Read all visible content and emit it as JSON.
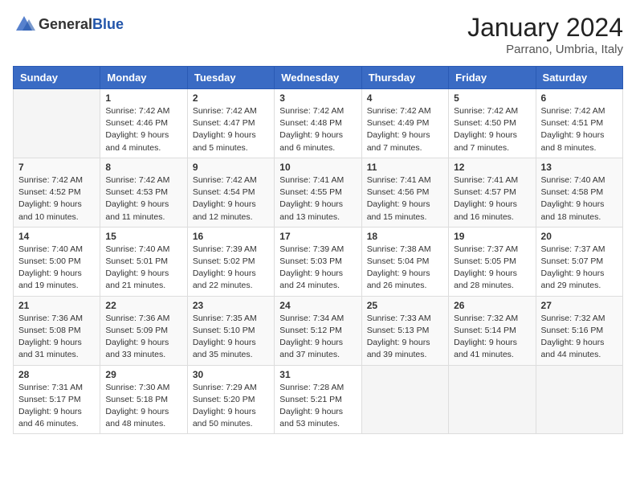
{
  "logo": {
    "general": "General",
    "blue": "Blue"
  },
  "header": {
    "month": "January 2024",
    "location": "Parrano, Umbria, Italy"
  },
  "weekdays": [
    "Sunday",
    "Monday",
    "Tuesday",
    "Wednesday",
    "Thursday",
    "Friday",
    "Saturday"
  ],
  "weeks": [
    [
      {
        "day": "",
        "sunrise": "",
        "sunset": "",
        "daylight": ""
      },
      {
        "day": "1",
        "sunrise": "Sunrise: 7:42 AM",
        "sunset": "Sunset: 4:46 PM",
        "daylight": "Daylight: 9 hours and 4 minutes."
      },
      {
        "day": "2",
        "sunrise": "Sunrise: 7:42 AM",
        "sunset": "Sunset: 4:47 PM",
        "daylight": "Daylight: 9 hours and 5 minutes."
      },
      {
        "day": "3",
        "sunrise": "Sunrise: 7:42 AM",
        "sunset": "Sunset: 4:48 PM",
        "daylight": "Daylight: 9 hours and 6 minutes."
      },
      {
        "day": "4",
        "sunrise": "Sunrise: 7:42 AM",
        "sunset": "Sunset: 4:49 PM",
        "daylight": "Daylight: 9 hours and 7 minutes."
      },
      {
        "day": "5",
        "sunrise": "Sunrise: 7:42 AM",
        "sunset": "Sunset: 4:50 PM",
        "daylight": "Daylight: 9 hours and 7 minutes."
      },
      {
        "day": "6",
        "sunrise": "Sunrise: 7:42 AM",
        "sunset": "Sunset: 4:51 PM",
        "daylight": "Daylight: 9 hours and 8 minutes."
      }
    ],
    [
      {
        "day": "7",
        "sunrise": "Sunrise: 7:42 AM",
        "sunset": "Sunset: 4:52 PM",
        "daylight": "Daylight: 9 hours and 10 minutes."
      },
      {
        "day": "8",
        "sunrise": "Sunrise: 7:42 AM",
        "sunset": "Sunset: 4:53 PM",
        "daylight": "Daylight: 9 hours and 11 minutes."
      },
      {
        "day": "9",
        "sunrise": "Sunrise: 7:42 AM",
        "sunset": "Sunset: 4:54 PM",
        "daylight": "Daylight: 9 hours and 12 minutes."
      },
      {
        "day": "10",
        "sunrise": "Sunrise: 7:41 AM",
        "sunset": "Sunset: 4:55 PM",
        "daylight": "Daylight: 9 hours and 13 minutes."
      },
      {
        "day": "11",
        "sunrise": "Sunrise: 7:41 AM",
        "sunset": "Sunset: 4:56 PM",
        "daylight": "Daylight: 9 hours and 15 minutes."
      },
      {
        "day": "12",
        "sunrise": "Sunrise: 7:41 AM",
        "sunset": "Sunset: 4:57 PM",
        "daylight": "Daylight: 9 hours and 16 minutes."
      },
      {
        "day": "13",
        "sunrise": "Sunrise: 7:40 AM",
        "sunset": "Sunset: 4:58 PM",
        "daylight": "Daylight: 9 hours and 18 minutes."
      }
    ],
    [
      {
        "day": "14",
        "sunrise": "Sunrise: 7:40 AM",
        "sunset": "Sunset: 5:00 PM",
        "daylight": "Daylight: 9 hours and 19 minutes."
      },
      {
        "day": "15",
        "sunrise": "Sunrise: 7:40 AM",
        "sunset": "Sunset: 5:01 PM",
        "daylight": "Daylight: 9 hours and 21 minutes."
      },
      {
        "day": "16",
        "sunrise": "Sunrise: 7:39 AM",
        "sunset": "Sunset: 5:02 PM",
        "daylight": "Daylight: 9 hours and 22 minutes."
      },
      {
        "day": "17",
        "sunrise": "Sunrise: 7:39 AM",
        "sunset": "Sunset: 5:03 PM",
        "daylight": "Daylight: 9 hours and 24 minutes."
      },
      {
        "day": "18",
        "sunrise": "Sunrise: 7:38 AM",
        "sunset": "Sunset: 5:04 PM",
        "daylight": "Daylight: 9 hours and 26 minutes."
      },
      {
        "day": "19",
        "sunrise": "Sunrise: 7:37 AM",
        "sunset": "Sunset: 5:05 PM",
        "daylight": "Daylight: 9 hours and 28 minutes."
      },
      {
        "day": "20",
        "sunrise": "Sunrise: 7:37 AM",
        "sunset": "Sunset: 5:07 PM",
        "daylight": "Daylight: 9 hours and 29 minutes."
      }
    ],
    [
      {
        "day": "21",
        "sunrise": "Sunrise: 7:36 AM",
        "sunset": "Sunset: 5:08 PM",
        "daylight": "Daylight: 9 hours and 31 minutes."
      },
      {
        "day": "22",
        "sunrise": "Sunrise: 7:36 AM",
        "sunset": "Sunset: 5:09 PM",
        "daylight": "Daylight: 9 hours and 33 minutes."
      },
      {
        "day": "23",
        "sunrise": "Sunrise: 7:35 AM",
        "sunset": "Sunset: 5:10 PM",
        "daylight": "Daylight: 9 hours and 35 minutes."
      },
      {
        "day": "24",
        "sunrise": "Sunrise: 7:34 AM",
        "sunset": "Sunset: 5:12 PM",
        "daylight": "Daylight: 9 hours and 37 minutes."
      },
      {
        "day": "25",
        "sunrise": "Sunrise: 7:33 AM",
        "sunset": "Sunset: 5:13 PM",
        "daylight": "Daylight: 9 hours and 39 minutes."
      },
      {
        "day": "26",
        "sunrise": "Sunrise: 7:32 AM",
        "sunset": "Sunset: 5:14 PM",
        "daylight": "Daylight: 9 hours and 41 minutes."
      },
      {
        "day": "27",
        "sunrise": "Sunrise: 7:32 AM",
        "sunset": "Sunset: 5:16 PM",
        "daylight": "Daylight: 9 hours and 44 minutes."
      }
    ],
    [
      {
        "day": "28",
        "sunrise": "Sunrise: 7:31 AM",
        "sunset": "Sunset: 5:17 PM",
        "daylight": "Daylight: 9 hours and 46 minutes."
      },
      {
        "day": "29",
        "sunrise": "Sunrise: 7:30 AM",
        "sunset": "Sunset: 5:18 PM",
        "daylight": "Daylight: 9 hours and 48 minutes."
      },
      {
        "day": "30",
        "sunrise": "Sunrise: 7:29 AM",
        "sunset": "Sunset: 5:20 PM",
        "daylight": "Daylight: 9 hours and 50 minutes."
      },
      {
        "day": "31",
        "sunrise": "Sunrise: 7:28 AM",
        "sunset": "Sunset: 5:21 PM",
        "daylight": "Daylight: 9 hours and 53 minutes."
      },
      {
        "day": "",
        "sunrise": "",
        "sunset": "",
        "daylight": ""
      },
      {
        "day": "",
        "sunrise": "",
        "sunset": "",
        "daylight": ""
      },
      {
        "day": "",
        "sunrise": "",
        "sunset": "",
        "daylight": ""
      }
    ]
  ]
}
